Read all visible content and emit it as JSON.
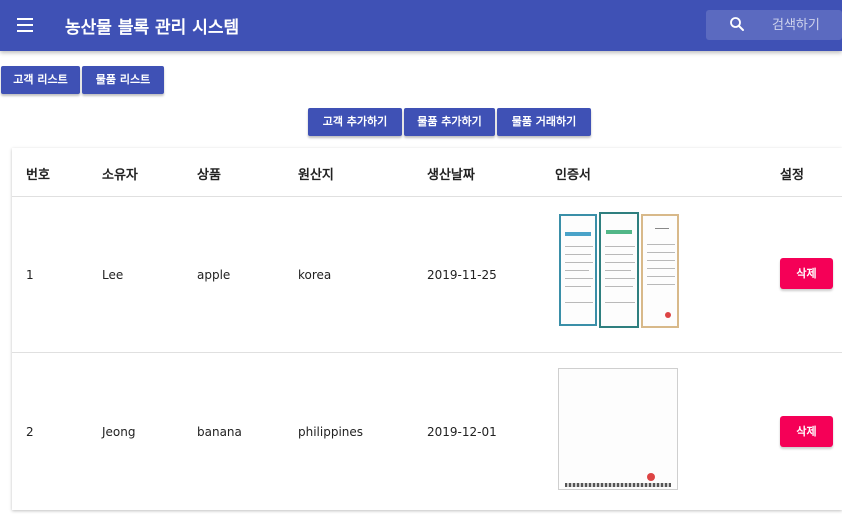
{
  "appbar": {
    "title": "농산물 블록 관리 시스템",
    "search_placeholder": "검색하기"
  },
  "top_nav": {
    "customer_list": "고객 리스트",
    "product_list": "물품 리스트"
  },
  "actions": {
    "add_customer": "고객 추가하기",
    "add_product": "물품 추가하기",
    "trade_product": "물품 거래하기"
  },
  "table": {
    "headers": {
      "no": "번호",
      "owner": "소유자",
      "product": "상품",
      "origin": "원산지",
      "date": "생산날짜",
      "cert": "인증서",
      "settings": "설정"
    },
    "rows": [
      {
        "no": "1",
        "owner": "Lee",
        "product": "apple",
        "origin": "korea",
        "date": "2019-11-25",
        "delete": "삭제"
      },
      {
        "no": "2",
        "owner": "Jeong",
        "product": "banana",
        "origin": "philippines",
        "date": "2019-12-01",
        "delete": "삭제"
      }
    ]
  },
  "colors": {
    "primary": "#3f51b5",
    "secondary": "#f50057"
  }
}
